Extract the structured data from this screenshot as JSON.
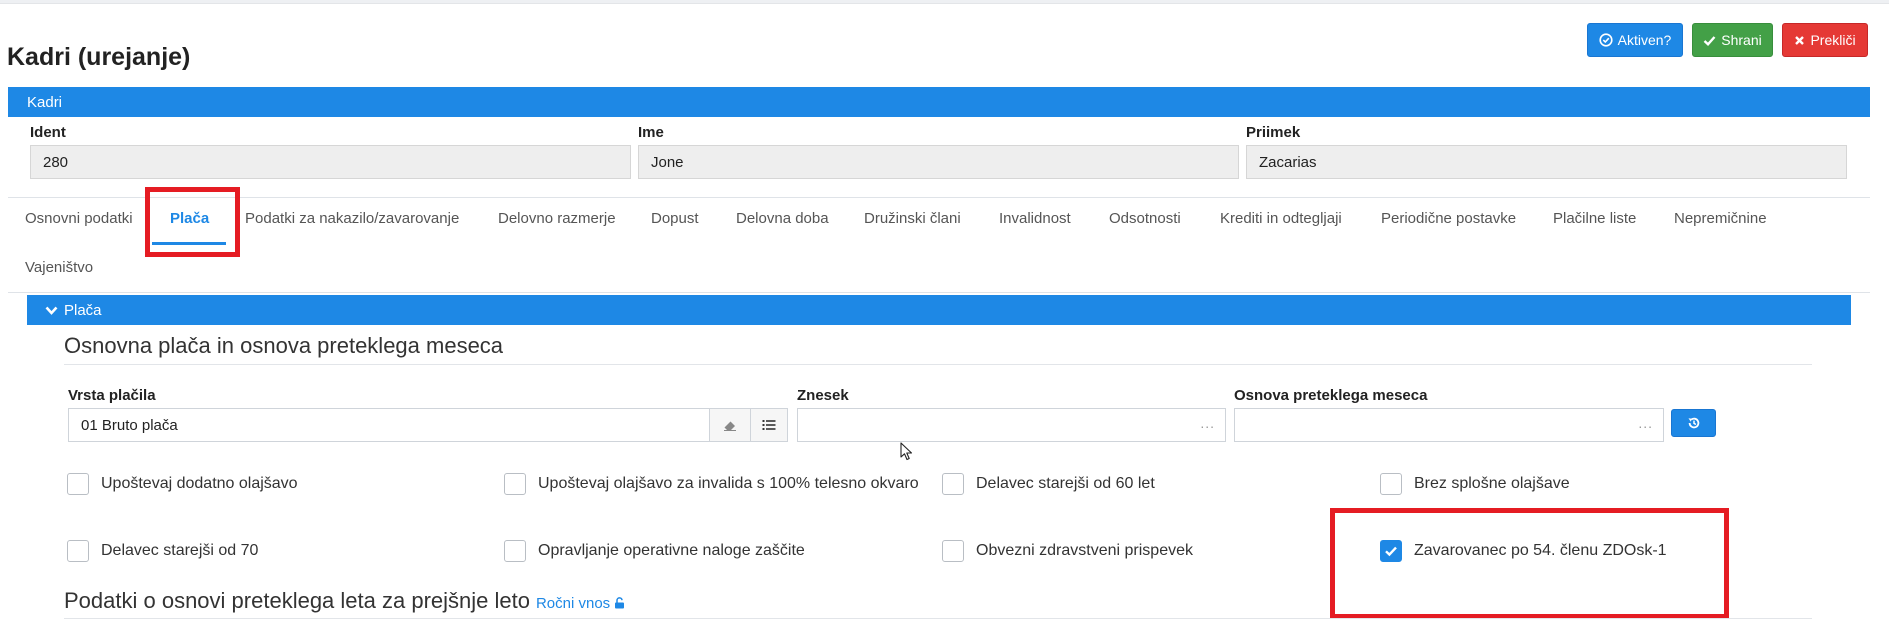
{
  "page": {
    "title": "Kadri (urejanje)"
  },
  "header_buttons": {
    "active": "Aktiven?",
    "save": "Shrani",
    "cancel": "Prekliči"
  },
  "kadri_panel": {
    "title": "Kadri",
    "fields": [
      {
        "label": "Ident",
        "value": "280"
      },
      {
        "label": "Ime",
        "value": "Jone"
      },
      {
        "label": "Priimek",
        "value": "Zacarias"
      }
    ]
  },
  "tabs": [
    {
      "label": "Osnovni podatki",
      "active": false
    },
    {
      "label": "Plača",
      "active": true
    },
    {
      "label": "Podatki za nakazilo/zavarovanje",
      "active": false
    },
    {
      "label": "Delovno razmerje",
      "active": false
    },
    {
      "label": "Dopust",
      "active": false
    },
    {
      "label": "Delovna doba",
      "active": false
    },
    {
      "label": "Družinski člani",
      "active": false
    },
    {
      "label": "Invalidnost",
      "active": false
    },
    {
      "label": "Odsotnosti",
      "active": false
    },
    {
      "label": "Krediti in odtegljaji",
      "active": false
    },
    {
      "label": "Periodične postavke",
      "active": false
    },
    {
      "label": "Plačilne liste",
      "active": false
    },
    {
      "label": "Nepremičnine",
      "active": false
    },
    {
      "label": "Vajeništvo",
      "active": false
    }
  ],
  "placa_panel": {
    "title": "Plača",
    "section1_title": "Osnovna plača in osnova preteklega meseca",
    "vrsta_placila": {
      "label": "Vrsta plačila",
      "value": "01 Bruto plača"
    },
    "znesek": {
      "label": "Znesek",
      "value": "",
      "dots": "..."
    },
    "osnova": {
      "label": "Osnova preteklega meseca",
      "value": "",
      "dots": "..."
    },
    "checkboxes": [
      {
        "label": "Upoštevaj dodatno olajšavo",
        "checked": false
      },
      {
        "label": "Upoštevaj olajšavo za invalida s 100% telesno okvaro",
        "checked": false
      },
      {
        "label": "Delavec starejši od 60 let",
        "checked": false
      },
      {
        "label": "Brez splošne olajšave",
        "checked": false
      },
      {
        "label": "Delavec starejši od 70",
        "checked": false
      },
      {
        "label": "Opravljanje operativne naloge zaščite",
        "checked": false
      },
      {
        "label": "Obvezni zdravstveni prispevek",
        "checked": false
      },
      {
        "label": "Zavarovanec po 54. členu ZDOsk-1",
        "checked": true
      }
    ],
    "section2_title": "Podatki o osnovi preteklega leta za prejšnje leto",
    "section2_link": "Ročni vnos"
  },
  "colors": {
    "primary": "#1e88e5",
    "success": "#43a047",
    "danger": "#e53935",
    "highlight": "#e51c23"
  }
}
